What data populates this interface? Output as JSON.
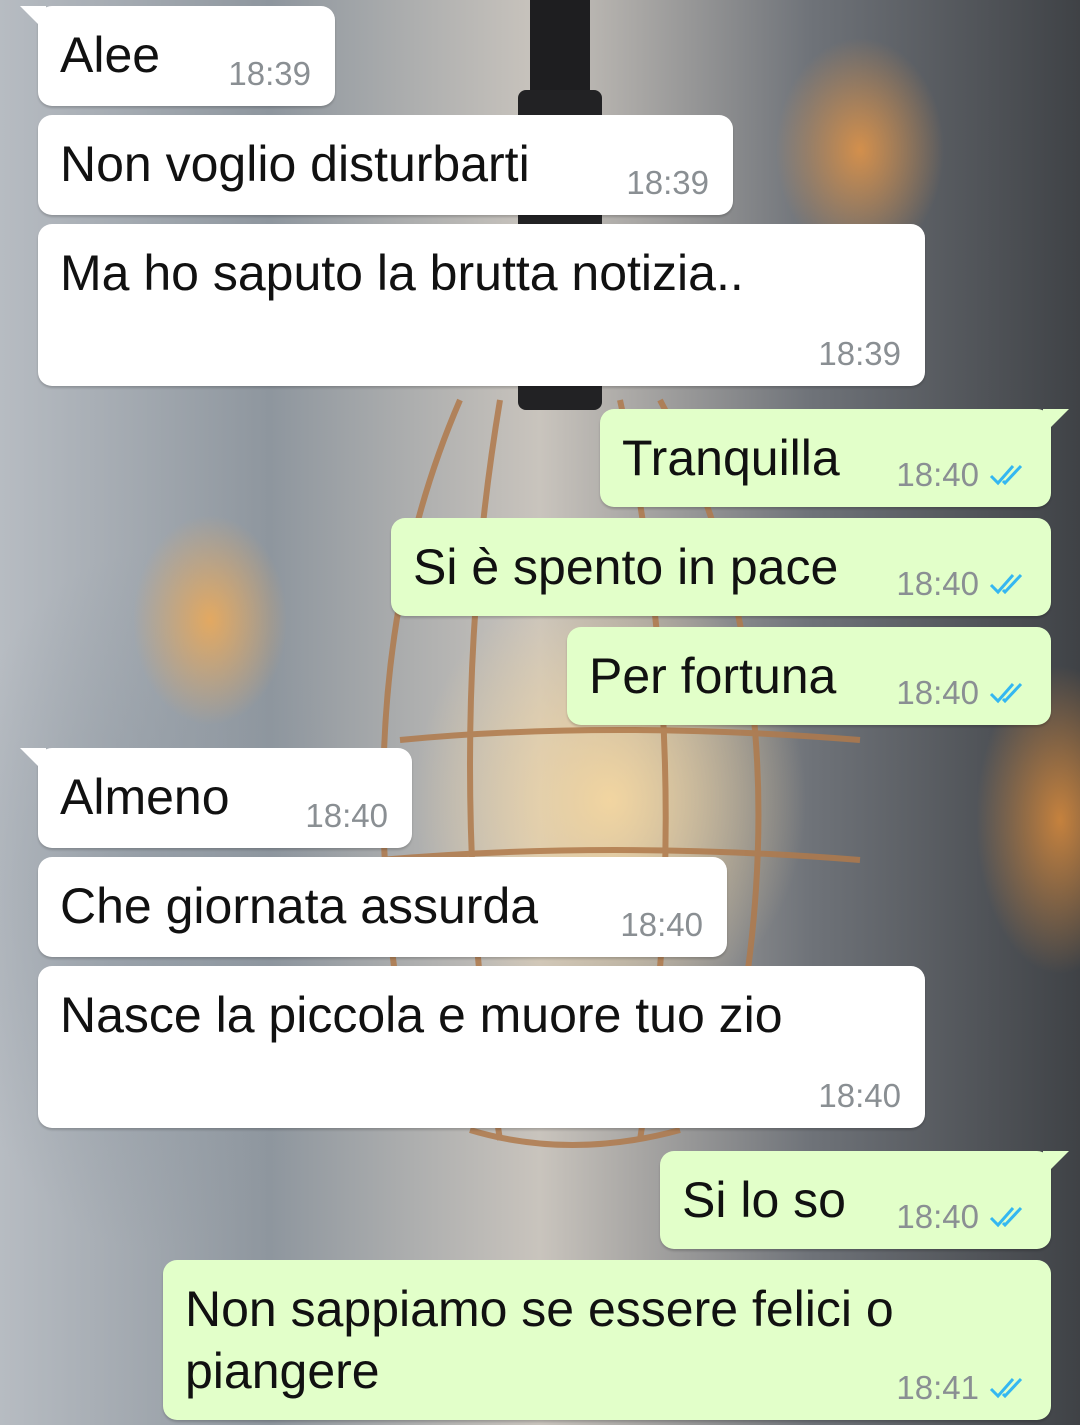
{
  "colors": {
    "incoming": "#ffffff",
    "outgoing": "#e2ffc9",
    "read_tick": "#34b7f1",
    "time": "#8a8f93"
  },
  "messages": [
    {
      "direction": "incoming",
      "text": "Alee",
      "time": "18:39"
    },
    {
      "direction": "incoming",
      "text": "Non voglio disturbarti",
      "time": "18:39"
    },
    {
      "direction": "incoming",
      "text": "Ma ho saputo la brutta notizia..",
      "time": "18:39"
    },
    {
      "direction": "outgoing",
      "text": "Tranquilla",
      "time": "18:40",
      "status_icon": "double-check-read-icon"
    },
    {
      "direction": "outgoing",
      "text": "Si è spento in pace",
      "time": "18:40",
      "status_icon": "double-check-read-icon"
    },
    {
      "direction": "outgoing",
      "text": "Per fortuna",
      "time": "18:40",
      "status_icon": "double-check-read-icon"
    },
    {
      "direction": "incoming",
      "text": "Almeno",
      "time": "18:40"
    },
    {
      "direction": "incoming",
      "text": "Che giornata assurda",
      "time": "18:40"
    },
    {
      "direction": "incoming",
      "text": "Nasce la piccola e muore tuo zio",
      "time": "18:40"
    },
    {
      "direction": "outgoing",
      "text": "Si lo so",
      "time": "18:40",
      "status_icon": "double-check-read-icon"
    },
    {
      "direction": "outgoing",
      "text": "Non sappiamo se essere felici o\npiangere",
      "time": "18:41",
      "status_icon": "double-check-read-icon"
    }
  ]
}
